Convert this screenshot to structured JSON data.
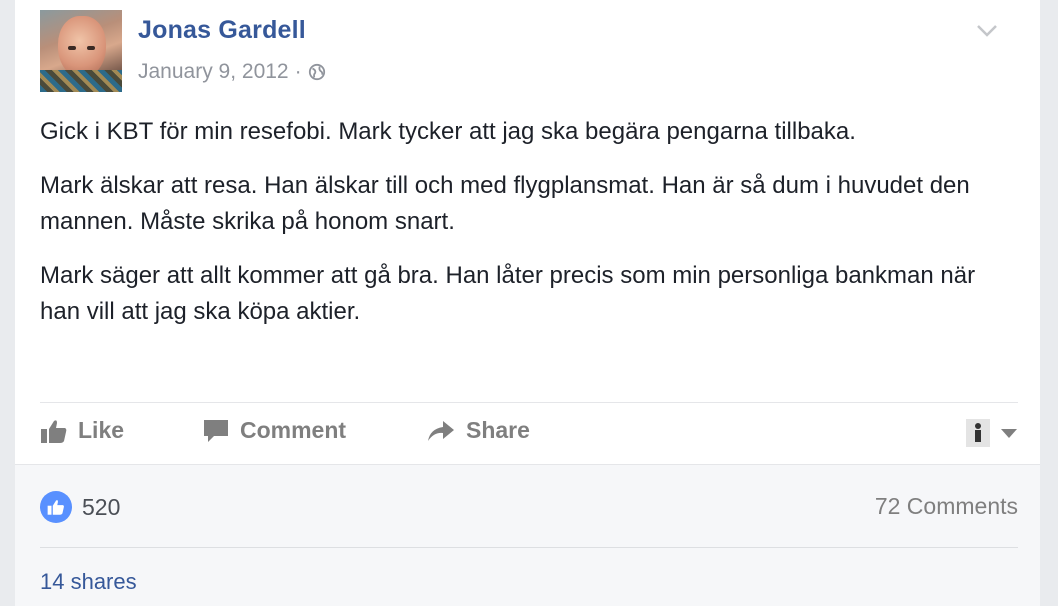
{
  "post": {
    "author": "Jonas Gardell",
    "date": "January 9, 2012",
    "separator": "·",
    "paragraphs": [
      "Gick i KBT för min resefobi. Mark tycker att jag ska begära pengarna tillbaka.",
      "Mark älskar att resa. Han älskar till och med flygplansmat. Han är så dum i huvudet den mannen. Måste skrika på honom snart.",
      "Mark säger att allt kommer att gå bra. Han låter precis som min personliga bankman när han vill att jag ska köpa aktier."
    ]
  },
  "actions": {
    "like": "Like",
    "comment": "Comment",
    "share": "Share"
  },
  "summary": {
    "likes": "520",
    "comments": "72 Comments",
    "shares": "14 shares"
  },
  "icons": {
    "visibility": "globe-icon",
    "menu": "chevron-down-icon",
    "like": "thumbs-up-icon",
    "comment": "speech-bubble-icon",
    "share": "share-arrow-icon"
  },
  "colors": {
    "author": "#365899",
    "muted": "#90949c",
    "like_badge": "#5890ff"
  }
}
